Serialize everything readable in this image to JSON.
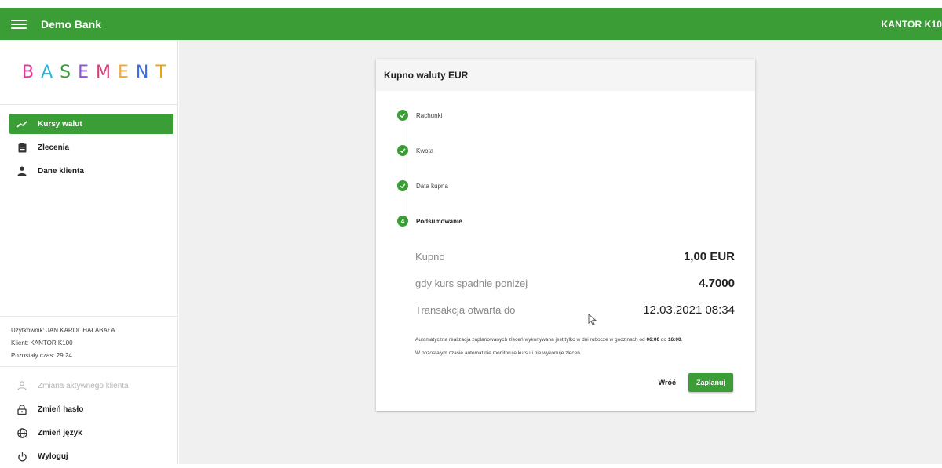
{
  "header": {
    "menu_icon": "hamburger-menu-icon",
    "app_title": "Demo Bank",
    "client_name": "KANTOR K10"
  },
  "sidebar": {
    "logo_letters": [
      "B",
      "A",
      "S",
      "E",
      "M",
      "E",
      "N",
      "T"
    ],
    "logo_colors": [
      "#e6399b",
      "#2bb6d6",
      "#3a9d36",
      "#8c54d8",
      "#d63e7a",
      "#f2a92f",
      "#3d6ee0",
      "#e8a21b"
    ],
    "nav": [
      {
        "label": "Kursy walut",
        "icon": "trending-up-icon",
        "active": true
      },
      {
        "label": "Zlecenia",
        "icon": "clipboard-icon",
        "active": false
      },
      {
        "label": "Dane klienta",
        "icon": "person-icon",
        "active": false
      }
    ],
    "user_info": {
      "user": "Użytkownik: JAN KAROL HAŁABAŁA",
      "client": "Klient: KANTOR K100",
      "time_left": "Pozostały czas: 29:24"
    },
    "bottom_nav": [
      {
        "label": "Zmiana aktywnego klienta",
        "icon": "person-outline-icon",
        "disabled": true
      },
      {
        "label": "Zmień hasło",
        "icon": "lock-icon",
        "disabled": false
      },
      {
        "label": "Zmień język",
        "icon": "globe-icon",
        "disabled": false
      },
      {
        "label": "Wyloguj",
        "icon": "power-icon",
        "disabled": false
      }
    ]
  },
  "card": {
    "title": "Kupno waluty EUR",
    "steps": [
      {
        "label": "Rachunki",
        "status": "done"
      },
      {
        "label": "Kwota",
        "status": "done"
      },
      {
        "label": "Data kupna",
        "status": "done"
      },
      {
        "label": "Podsumowanie",
        "status": "current",
        "number": "4"
      }
    ],
    "summary": [
      {
        "label": "Kupno",
        "value": "1,00 EUR"
      },
      {
        "label": "gdy kurs spadnie poniżej",
        "value": "4.7000"
      },
      {
        "label": "Transakcja otwarta do",
        "value": "12.03.2021 08:34"
      }
    ],
    "note": {
      "line1_prefix": "Automatyczna realizacja zaplanowanych zleceń wykonywana jest tylko w dni robocze w godzinach od ",
      "time_from": "06:00",
      "line1_mid": " do ",
      "time_to": "16:00",
      "line1_suffix": ".",
      "line2": "W pozostałym czasie automat nie monitoruje kursu i nie wykonuje zleceń."
    },
    "buttons": {
      "back": "Wróć",
      "plan": "Zaplanuj"
    }
  },
  "colors": {
    "primary": "#3a9d36",
    "main_bg": "#f0f0f0"
  }
}
